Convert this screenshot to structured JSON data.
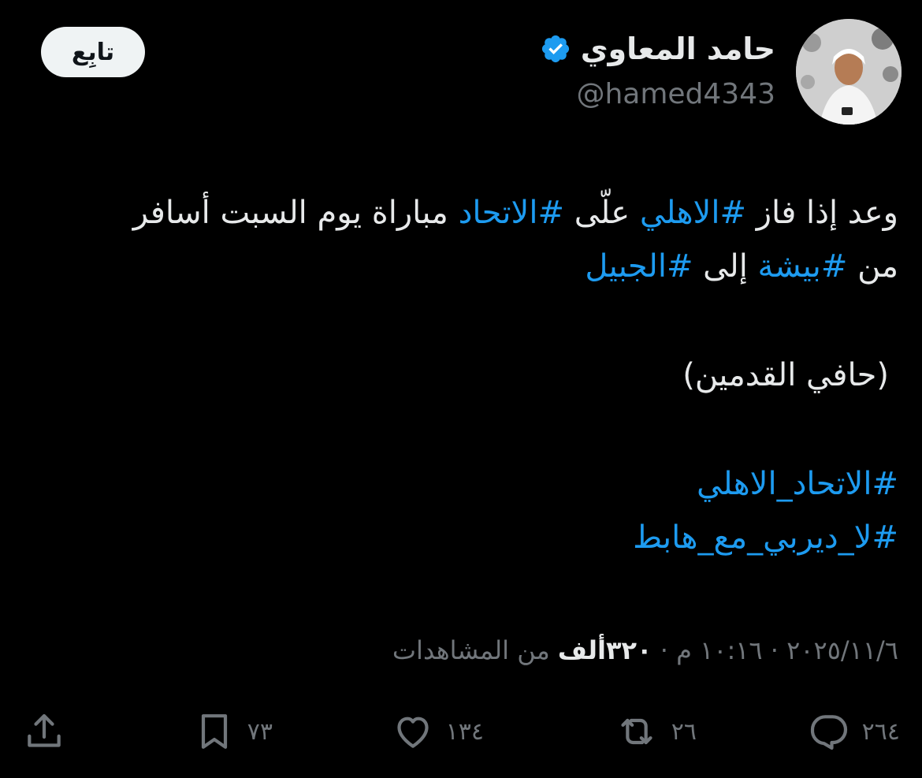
{
  "author": {
    "name": "حامد المعاوي",
    "handle": "@hamed4343",
    "verified": true
  },
  "follow_label": "تابِع",
  "tweet": {
    "line1": [
      {
        "t": "وعد إذا فاز ",
        "tag": false
      },
      {
        "t": "#الاهلي",
        "tag": true
      },
      {
        "t": " علّى ",
        "tag": false
      },
      {
        "t": "#الاتحاد",
        "tag": true
      },
      {
        "t": " مباراة يوم السبت أسافر",
        "tag": false
      }
    ],
    "line2": [
      {
        "t": "من ",
        "tag": false
      },
      {
        "t": "#بيشة",
        "tag": true
      },
      {
        "t": " إلى ",
        "tag": false
      },
      {
        "t": "#الجبيل",
        "tag": true
      }
    ],
    "line3": "(حافي القدمين)",
    "hashtag1": "#الاتحاد_الاهلي",
    "hashtag2": "#لا_ديربي_مع_هابط"
  },
  "meta": {
    "date": "٢٠٢٥/١١/٦",
    "time": "١٠:١٦ م",
    "views_count": "٣٢٠ألف",
    "views_label": "من المشاهدات",
    "separator": "·"
  },
  "actions": {
    "replies": "٢٦٤",
    "reposts": "٢٦",
    "likes": "١٣٤",
    "bookmarks": "٧٣"
  },
  "colors": {
    "background": "#000000",
    "text": "#e7e9ea",
    "secondary": "#71767b",
    "link": "#1d9bf0",
    "follow_bg": "#eff3f4"
  }
}
